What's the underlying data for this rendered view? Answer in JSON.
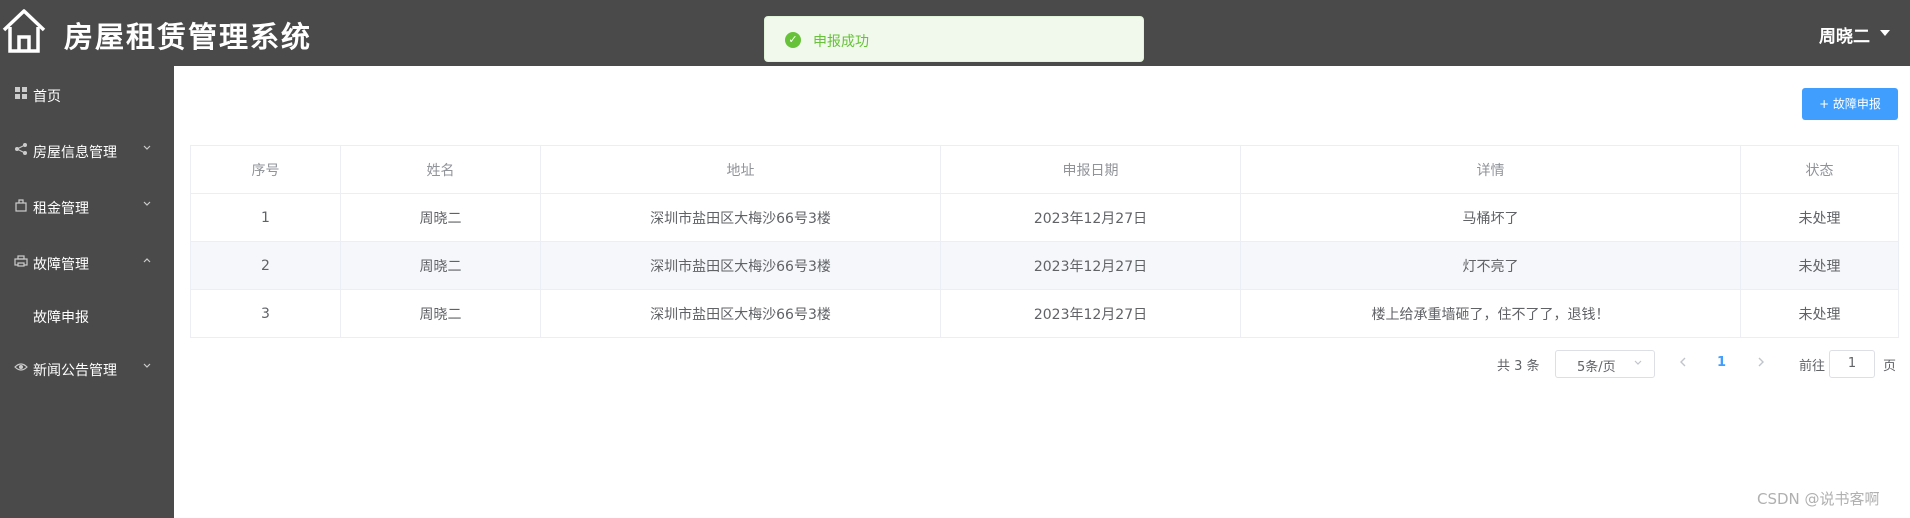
{
  "header": {
    "title": "房屋租赁管理系统",
    "user_name": "周晓二",
    "logo_icon": "house-icon"
  },
  "toast": {
    "message": "申报成功",
    "color": "#67c23a"
  },
  "sidebar": {
    "items": [
      {
        "label": "首页",
        "icon": "grid-icon"
      },
      {
        "label": "房屋信息管理",
        "icon": "share-icon"
      },
      {
        "label": "租金管理",
        "icon": "bag-icon"
      },
      {
        "label": "故障管理",
        "icon": "printer-icon",
        "expanded": true
      },
      {
        "label": "新闻公告管理",
        "icon": "eye-icon"
      }
    ],
    "submenu": {
      "label": "故障申报"
    }
  },
  "toolbar": {
    "add_label": "+ 故障申报"
  },
  "table": {
    "columns": [
      "序号",
      "姓名",
      "地址",
      "申报日期",
      "详情",
      "状态"
    ],
    "rows": [
      [
        "1",
        "周晓二",
        "深圳市盐田区大梅沙66号3楼",
        "2023年12月27日",
        "马桶坏了",
        "未处理"
      ],
      [
        "2",
        "周晓二",
        "深圳市盐田区大梅沙66号3楼",
        "2023年12月27日",
        "灯不亮了",
        "未处理"
      ],
      [
        "3",
        "周晓二",
        "深圳市盐田区大梅沙66号3楼",
        "2023年12月27日",
        "楼上给承重墙砸了，住不了了，退钱！",
        "未处理"
      ]
    ]
  },
  "pagination": {
    "total_text": "共 3 条",
    "page_size": "5条/页",
    "current_page": "1",
    "goto_label": "前往",
    "goto_value": "1",
    "page_suffix": "页"
  },
  "watermark": "CSDN @说书客啊",
  "colors": {
    "header_bg": "#4a4a4a",
    "accent": "#409eff"
  }
}
